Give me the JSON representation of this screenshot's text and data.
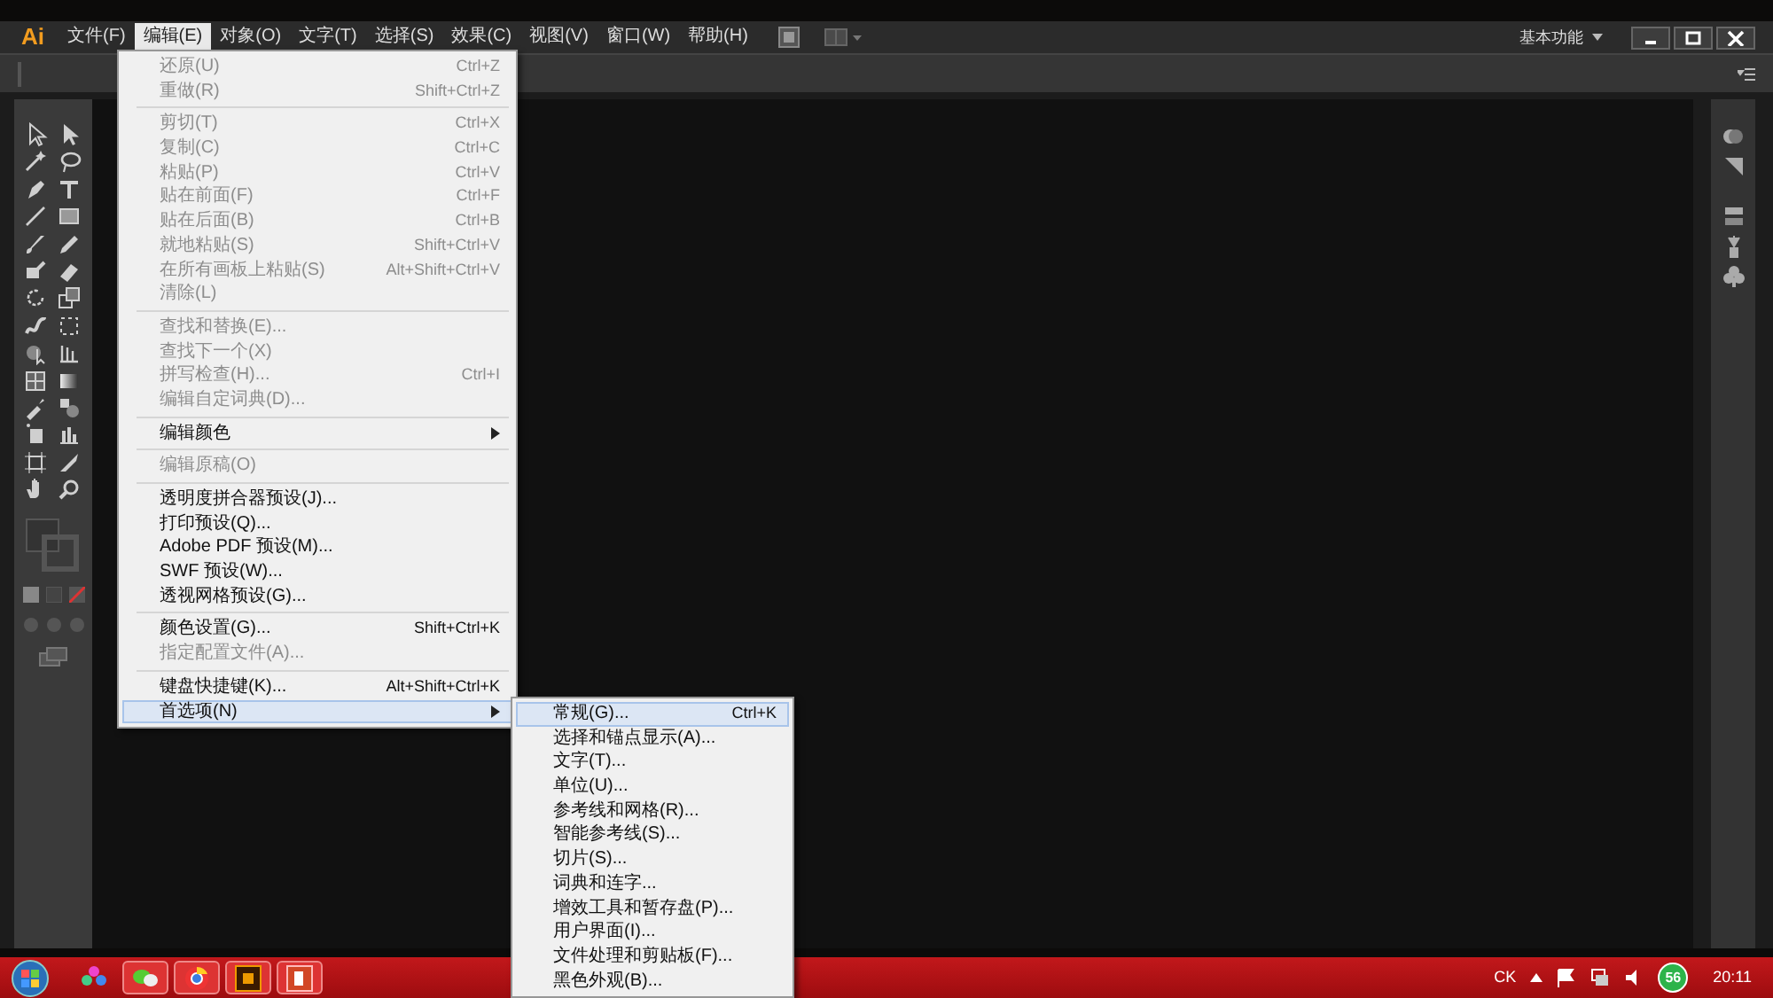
{
  "app": {
    "logo": "Ai",
    "workspace": "基本功能"
  },
  "menu_bar": {
    "menus": [
      {
        "label": "文件(F)",
        "selected": false
      },
      {
        "label": "编辑(E)",
        "selected": true
      },
      {
        "label": "对象(O)",
        "selected": false
      },
      {
        "label": "文字(T)",
        "selected": false
      },
      {
        "label": "选择(S)",
        "selected": false
      },
      {
        "label": "效果(C)",
        "selected": false
      },
      {
        "label": "视图(V)",
        "selected": false
      },
      {
        "label": "窗口(W)",
        "selected": false
      },
      {
        "label": "帮助(H)",
        "selected": false
      }
    ]
  },
  "edit_menu": {
    "items": [
      {
        "kind": "item",
        "label": "还原(U)",
        "shortcut": "Ctrl+Z",
        "disabled": true,
        "has_submenu": false,
        "selected": false
      },
      {
        "kind": "item",
        "label": "重做(R)",
        "shortcut": "Shift+Ctrl+Z",
        "disabled": true,
        "has_submenu": false,
        "selected": false
      },
      {
        "kind": "separator"
      },
      {
        "kind": "item",
        "label": "剪切(T)",
        "shortcut": "Ctrl+X",
        "disabled": true,
        "has_submenu": false,
        "selected": false
      },
      {
        "kind": "item",
        "label": "复制(C)",
        "shortcut": "Ctrl+C",
        "disabled": true,
        "has_submenu": false,
        "selected": false
      },
      {
        "kind": "item",
        "label": "粘贴(P)",
        "shortcut": "Ctrl+V",
        "disabled": true,
        "has_submenu": false,
        "selected": false
      },
      {
        "kind": "item",
        "label": "贴在前面(F)",
        "shortcut": "Ctrl+F",
        "disabled": true,
        "has_submenu": false,
        "selected": false
      },
      {
        "kind": "item",
        "label": "贴在后面(B)",
        "shortcut": "Ctrl+B",
        "disabled": true,
        "has_submenu": false,
        "selected": false
      },
      {
        "kind": "item",
        "label": "就地粘贴(S)",
        "shortcut": "Shift+Ctrl+V",
        "disabled": true,
        "has_submenu": false,
        "selected": false
      },
      {
        "kind": "item",
        "label": "在所有画板上粘贴(S)",
        "shortcut": "Alt+Shift+Ctrl+V",
        "disabled": true,
        "has_submenu": false,
        "selected": false
      },
      {
        "kind": "item",
        "label": "清除(L)",
        "disabled": true,
        "has_submenu": false,
        "selected": false
      },
      {
        "kind": "separator"
      },
      {
        "kind": "item",
        "label": "查找和替换(E)...",
        "disabled": true,
        "has_submenu": false,
        "selected": false
      },
      {
        "kind": "item",
        "label": "查找下一个(X)",
        "disabled": true,
        "has_submenu": false,
        "selected": false
      },
      {
        "kind": "item",
        "label": "拼写检查(H)...",
        "shortcut": "Ctrl+I",
        "disabled": true,
        "has_submenu": false,
        "selected": false
      },
      {
        "kind": "item",
        "label": "编辑自定词典(D)...",
        "disabled": true,
        "has_submenu": false,
        "selected": false
      },
      {
        "kind": "separator"
      },
      {
        "kind": "item",
        "label": "编辑颜色",
        "disabled": false,
        "has_submenu": true,
        "selected": false
      },
      {
        "kind": "separator"
      },
      {
        "kind": "item",
        "label": "编辑原稿(O)",
        "disabled": true,
        "has_submenu": false,
        "selected": false
      },
      {
        "kind": "separator"
      },
      {
        "kind": "item",
        "label": "透明度拼合器预设(J)...",
        "disabled": false,
        "has_submenu": false,
        "selected": false
      },
      {
        "kind": "item",
        "label": "打印预设(Q)...",
        "disabled": false,
        "has_submenu": false,
        "selected": false
      },
      {
        "kind": "item",
        "label": "Adobe PDF 预设(M)...",
        "disabled": false,
        "has_submenu": false,
        "selected": false
      },
      {
        "kind": "item",
        "label": "SWF 预设(W)...",
        "disabled": false,
        "has_submenu": false,
        "selected": false
      },
      {
        "kind": "item",
        "label": "透视网格预设(G)...",
        "disabled": false,
        "has_submenu": false,
        "selected": false
      },
      {
        "kind": "separator"
      },
      {
        "kind": "item",
        "label": "颜色设置(G)...",
        "shortcut": "Shift+Ctrl+K",
        "disabled": false,
        "has_submenu": false,
        "selected": false
      },
      {
        "kind": "item",
        "label": "指定配置文件(A)...",
        "disabled": true,
        "has_submenu": false,
        "selected": false
      },
      {
        "kind": "separator"
      },
      {
        "kind": "item",
        "label": "键盘快捷键(K)...",
        "shortcut": "Alt+Shift+Ctrl+K",
        "disabled": false,
        "has_submenu": false,
        "selected": false
      },
      {
        "kind": "item",
        "label": "首选项(N)",
        "disabled": false,
        "has_submenu": true,
        "selected": true
      }
    ]
  },
  "preferences_submenu": {
    "items": [
      {
        "label": "常规(G)...",
        "shortcut": "Ctrl+K",
        "selected": true
      },
      {
        "label": "选择和锚点显示(A)...",
        "selected": false
      },
      {
        "label": "文字(T)...",
        "selected": false
      },
      {
        "label": "单位(U)...",
        "selected": false
      },
      {
        "label": "参考线和网格(R)...",
        "selected": false
      },
      {
        "label": "智能参考线(S)...",
        "selected": false
      },
      {
        "label": "切片(S)...",
        "selected": false
      },
      {
        "label": "词典和连字...",
        "selected": false
      },
      {
        "label": "增效工具和暂存盘(P)...",
        "selected": false
      },
      {
        "label": "用户界面(I)...",
        "selected": false
      },
      {
        "label": "文件处理和剪贴板(F)...",
        "selected": false
      },
      {
        "label": "黑色外观(B)...",
        "selected": false
      }
    ]
  },
  "taskbar": {
    "input_indicator": "CK",
    "badge": "56",
    "clock": "20:11"
  }
}
